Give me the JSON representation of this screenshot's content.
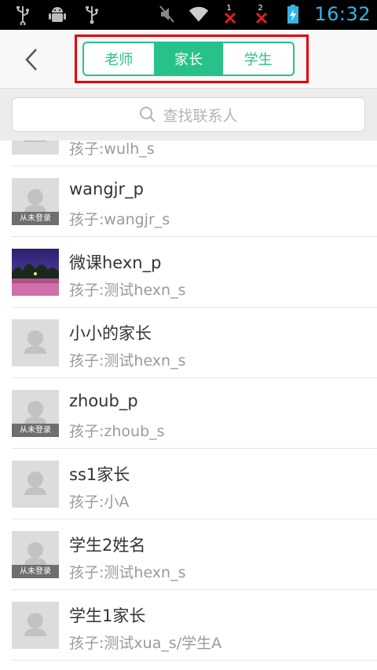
{
  "status_bar": {
    "time": "16:32",
    "sim1": "1",
    "sim2": "2",
    "time_color": "#33b5e5"
  },
  "header": {
    "tabs": [
      {
        "label": "老师",
        "active": false
      },
      {
        "label": "家长",
        "active": true
      },
      {
        "label": "学生",
        "active": false
      }
    ],
    "accent_color": "#27c28a",
    "highlight_color": "#e00000"
  },
  "search": {
    "placeholder": "查找联系人"
  },
  "contacts": [
    {
      "name": "",
      "child": "孩子:wulh_s",
      "badge": "",
      "avatar": "placeholder"
    },
    {
      "name": "wangjr_p",
      "child": "孩子:wangjr_s",
      "badge": "从未登录",
      "avatar": "placeholder"
    },
    {
      "name": "微课hexn_p",
      "child": "孩子:测试hexn_s",
      "badge": "",
      "avatar": "photo"
    },
    {
      "name": "小小的家长",
      "child": "孩子:测试hexn_s",
      "badge": "",
      "avatar": "placeholder"
    },
    {
      "name": "zhoub_p",
      "child": "孩子:zhoub_s",
      "badge": "从未登录",
      "avatar": "placeholder"
    },
    {
      "name": "ss1家长",
      "child": "孩子:小A",
      "badge": "",
      "avatar": "placeholder"
    },
    {
      "name": "学生2姓名",
      "child": "孩子:测试hexn_s",
      "badge": "从未登录",
      "avatar": "placeholder"
    },
    {
      "name": "学生1家长",
      "child": "孩子:测试xua_s/学生A",
      "badge": "",
      "avatar": "placeholder"
    }
  ]
}
